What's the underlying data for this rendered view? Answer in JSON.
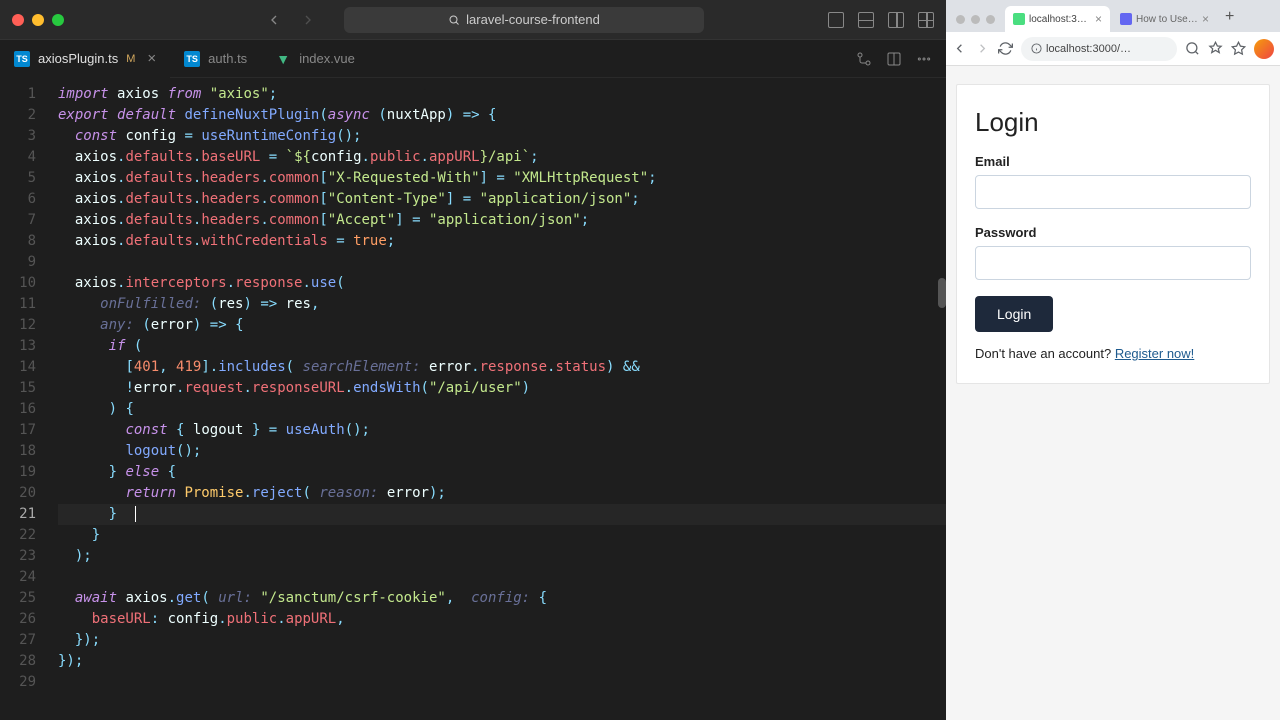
{
  "ide": {
    "project": "laravel-course-frontend",
    "tabs": [
      {
        "icon": "ts",
        "label": "axiosPlugin.ts",
        "modified": "M",
        "active": true,
        "close": true
      },
      {
        "icon": "ts",
        "label": "auth.ts",
        "active": false
      },
      {
        "icon": "vue",
        "label": "index.vue",
        "active": false
      }
    ],
    "code": {
      "lines": [
        {
          "n": 1,
          "html": "<span class='kw'>import</span> <span class='var'>axios</span> <span class='kw'>from</span> <span class='str'>\"axios\"</span><span class='op'>;</span>"
        },
        {
          "n": 2,
          "html": "<span class='kw'>export</span> <span class='kw'>default</span> <span class='fn'>defineNuxtPlugin</span><span class='op'>(</span><span class='kw'>async</span> <span class='op'>(</span><span class='var'>nuxtApp</span><span class='op'>)</span> <span class='op'>=&gt;</span> <span class='op'>{</span>"
        },
        {
          "n": 3,
          "html": "  <span class='kw'>const</span> <span class='var'>config</span> <span class='op'>=</span> <span class='fn'>useRuntimeConfig</span><span class='op'>();</span>"
        },
        {
          "n": 4,
          "html": "  <span class='var'>axios</span><span class='op'>.</span><span class='prop'>defaults</span><span class='op'>.</span><span class='prop'>baseURL</span> <span class='op'>=</span> <span class='str'>`${</span><span class='var'>config</span><span class='op'>.</span><span class='prop'>public</span><span class='op'>.</span><span class='prop'>appURL</span><span class='str'>}/api`</span><span class='op'>;</span>"
        },
        {
          "n": 5,
          "html": "  <span class='var'>axios</span><span class='op'>.</span><span class='prop'>defaults</span><span class='op'>.</span><span class='prop'>headers</span><span class='op'>.</span><span class='prop'>common</span><span class='op'>[</span><span class='str'>\"X-Requested-With\"</span><span class='op'>]</span> <span class='op'>=</span> <span class='str'>\"XMLHttpRequest\"</span><span class='op'>;</span>"
        },
        {
          "n": 6,
          "html": "  <span class='var'>axios</span><span class='op'>.</span><span class='prop'>defaults</span><span class='op'>.</span><span class='prop'>headers</span><span class='op'>.</span><span class='prop'>common</span><span class='op'>[</span><span class='str'>\"Content-Type\"</span><span class='op'>]</span> <span class='op'>=</span> <span class='str'>\"application/json\"</span><span class='op'>;</span>"
        },
        {
          "n": 7,
          "html": "  <span class='var'>axios</span><span class='op'>.</span><span class='prop'>defaults</span><span class='op'>.</span><span class='prop'>headers</span><span class='op'>.</span><span class='prop'>common</span><span class='op'>[</span><span class='str'>\"Accept\"</span><span class='op'>]</span> <span class='op'>=</span> <span class='str'>\"application/json\"</span><span class='op'>;</span>"
        },
        {
          "n": 8,
          "html": "  <span class='var'>axios</span><span class='op'>.</span><span class='prop'>defaults</span><span class='op'>.</span><span class='prop'>withCredentials</span> <span class='op'>=</span> <span class='bool'>true</span><span class='op'>;</span>"
        },
        {
          "n": 9,
          "html": ""
        },
        {
          "n": 10,
          "html": "  <span class='var'>axios</span><span class='op'>.</span><span class='prop'>interceptors</span><span class='op'>.</span><span class='prop'>response</span><span class='op'>.</span><span class='fn'>use</span><span class='op'>(</span>"
        },
        {
          "n": 11,
          "html": "     <span class='cmt'>onFulfilled:</span> <span class='op'>(</span><span class='var'>res</span><span class='op'>)</span> <span class='op'>=&gt;</span> <span class='var'>res</span><span class='op'>,</span>"
        },
        {
          "n": 12,
          "html": "     <span class='cmt'>any:</span> <span class='op'>(</span><span class='var'>error</span><span class='op'>)</span> <span class='op'>=&gt;</span> <span class='op'>{</span>"
        },
        {
          "n": 13,
          "html": "      <span class='kw'>if</span> <span class='op'>(</span>"
        },
        {
          "n": 14,
          "html": "        <span class='op'>[</span><span class='num'>401</span><span class='op'>,</span> <span class='num'>419</span><span class='op'>].</span><span class='fn'>includes</span><span class='op'>(</span> <span class='cmt'>searchElement:</span> <span class='var'>error</span><span class='op'>.</span><span class='prop'>response</span><span class='op'>.</span><span class='prop'>status</span><span class='op'>)</span> <span class='op'>&amp;&amp;</span>"
        },
        {
          "n": 15,
          "html": "        <span class='op'>!</span><span class='var'>error</span><span class='op'>.</span><span class='prop'>request</span><span class='op'>.</span><span class='prop'>responseURL</span><span class='op'>.</span><span class='fn'>endsWith</span><span class='op'>(</span><span class='str'>\"/api/user\"</span><span class='op'>)</span>"
        },
        {
          "n": 16,
          "html": "      <span class='op'>)</span> <span class='op'>{</span>"
        },
        {
          "n": 17,
          "html": "        <span class='kw'>const</span> <span class='op'>{</span> <span class='var'>logout</span> <span class='op'>}</span> <span class='op'>=</span> <span class='fn'>useAuth</span><span class='op'>();</span>"
        },
        {
          "n": 18,
          "html": "        <span class='fn'>logout</span><span class='op'>();</span>"
        },
        {
          "n": 19,
          "html": "      <span class='op'>}</span> <span class='kw'>else</span> <span class='op'>{</span>"
        },
        {
          "n": 20,
          "html": "        <span class='kw'>return</span> <span class='type'>Promise</span><span class='op'>.</span><span class='fn'>reject</span><span class='op'>(</span> <span class='cmt'>reason:</span> <span class='var'>error</span><span class='op'>);</span>"
        },
        {
          "n": 21,
          "html": "      <span class='op'>}</span><span class='text-cursor'></span>",
          "cur": true
        },
        {
          "n": 22,
          "html": "    <span class='op'>}</span>"
        },
        {
          "n": 23,
          "html": "  <span class='op'>);</span>"
        },
        {
          "n": 24,
          "html": ""
        },
        {
          "n": 25,
          "html": "  <span class='kw'>await</span> <span class='var'>axios</span><span class='op'>.</span><span class='fn'>get</span><span class='op'>(</span> <span class='cmt'>url:</span> <span class='str'>\"/sanctum/csrf-cookie\"</span><span class='op'>,</span>  <span class='cmt'>config:</span> <span class='op'>{</span>"
        },
        {
          "n": 26,
          "html": "    <span class='prop'>baseURL</span><span class='op'>:</span> <span class='var'>config</span><span class='op'>.</span><span class='prop'>public</span><span class='op'>.</span><span class='prop'>appURL</span><span class='op'>,</span>"
        },
        {
          "n": 27,
          "html": "  <span class='op'>});</span>"
        },
        {
          "n": 28,
          "html": "<span class='op'>});</span>"
        },
        {
          "n": 29,
          "html": ""
        }
      ]
    }
  },
  "browser": {
    "tabs": [
      {
        "label": "localhost:30…",
        "active": true
      },
      {
        "label": "How to Use l…",
        "active": false
      }
    ],
    "url": "localhost:3000/…",
    "login": {
      "title": "Login",
      "email_label": "Email",
      "password_label": "Password",
      "button": "Login",
      "register_prompt": "Don't have an account? ",
      "register_link": "Register now!"
    }
  }
}
